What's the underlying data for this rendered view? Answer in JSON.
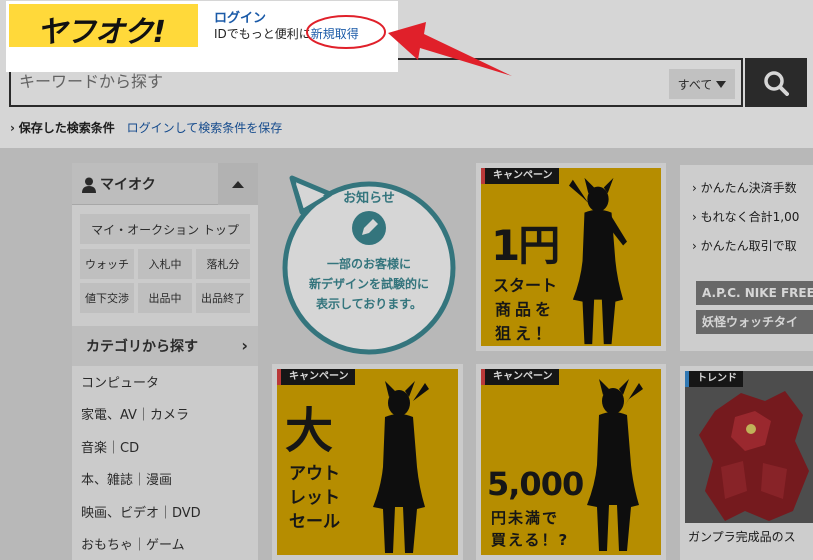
{
  "header": {
    "logo_text": "ヤフオク!",
    "login_label": "ログイン",
    "login_sub_prefix": "IDでもっと便利に",
    "register_label": "新規取得"
  },
  "search": {
    "placeholder": "キーワードから探す",
    "scope_label": "すべて"
  },
  "saved_search": {
    "label": "保存した検索条件",
    "link": "ログインして検索条件を保存"
  },
  "sidebar": {
    "my_title": "マイオク",
    "my_top": "マイ・オークション トップ",
    "my_items": [
      "ウォッチ",
      "入札中",
      "落札分",
      "値下交渉",
      "出品中",
      "出品終了"
    ],
    "category_title": "カテゴリから探す",
    "categories": [
      "コンピュータ",
      "家電、AV｜カメラ",
      "音楽｜CD",
      "本、雑誌｜漫画",
      "映画、ビデオ｜DVD",
      "おもちゃ｜ゲーム"
    ]
  },
  "notice": {
    "title": "お知らせ",
    "lines": [
      "一部のお客様に",
      "新デザインを試験的に",
      "表示しております。"
    ]
  },
  "cards": {
    "c1": {
      "tag": "キャンペーン",
      "big": "1円",
      "lines": [
        "スタート",
        "商品を",
        "狙え！"
      ]
    },
    "c2": {
      "tag": "キャンペーン",
      "big": "大",
      "lines": [
        "アウト",
        "レット",
        "セール"
      ]
    },
    "c3": {
      "tag": "キャンペーン",
      "big": "5,000",
      "lines": [
        "円未満で",
        "買える！?"
      ]
    }
  },
  "news": {
    "items": [
      "かんたん決済手数",
      "もれなく合計1,00",
      "かんたん取引で取"
    ],
    "pills": [
      "A.P.C. NIKE FREE",
      "妖怪ウォッチタイ"
    ]
  },
  "trend": {
    "tag": "トレンド",
    "caption": "ガンプラ完成品のス"
  },
  "colors": {
    "brand_yellow": "#ffd93a",
    "link_blue": "#1a5aa8",
    "card_gold": "#d9a900",
    "callout_red": "#e0202a"
  }
}
